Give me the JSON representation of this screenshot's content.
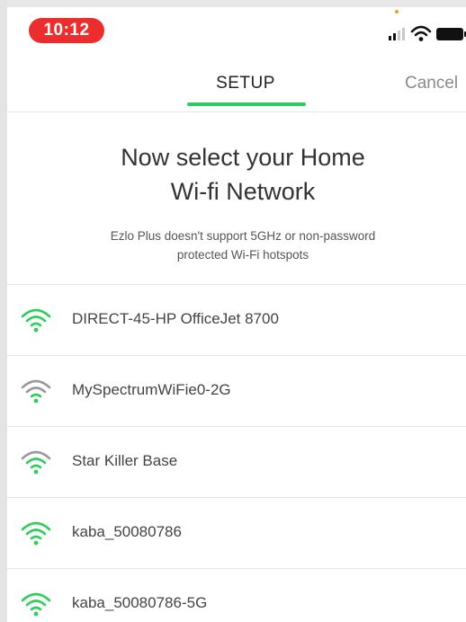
{
  "status_bar": {
    "time": "10:12"
  },
  "nav": {
    "title": "SETUP",
    "cancel_label": "Cancel"
  },
  "heading": {
    "line1": "Now select your Home",
    "line2": "Wi-fi Network"
  },
  "subtext": {
    "line1": "Ezlo Plus doesn't support 5GHz or non-password",
    "line2": "protected Wi-Fi hotspots"
  },
  "networks": [
    {
      "name": "DIRECT-45-HP OfficeJet 8700",
      "signal": "strong"
    },
    {
      "name": "MySpectrumWiFie0-2G",
      "signal": "weak"
    },
    {
      "name": "Star Killer Base",
      "signal": "medium"
    },
    {
      "name": "kaba_50080786",
      "signal": "strong"
    },
    {
      "name": "kaba_50080786-5G",
      "signal": "strong"
    }
  ],
  "colors": {
    "accent": "#2fcd5c",
    "time_pill": "#ec2d2d",
    "wifi_inactive": "#9a9a9a"
  },
  "icons": {
    "signal": "cellular-signal-icon",
    "wifi_status": "wifi-icon",
    "battery": "battery-icon",
    "network": "wifi-signal-icon"
  }
}
